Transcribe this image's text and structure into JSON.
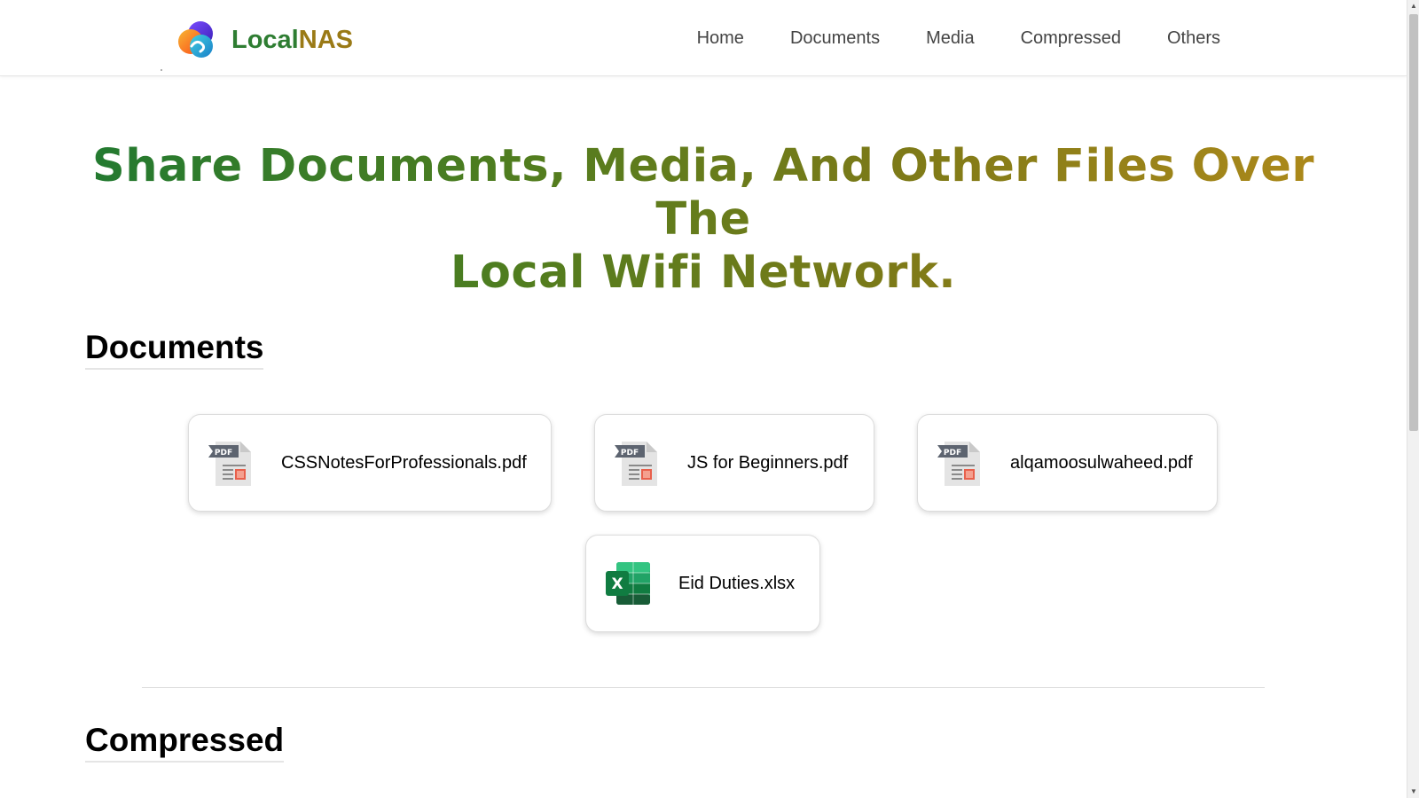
{
  "header": {
    "brand_local": "Local",
    "brand_nas": "NAS",
    "nav": [
      "Home",
      "Documents",
      "Media",
      "Compressed",
      "Others"
    ]
  },
  "hero": {
    "line1": "Share Documents, Media, And Other Files Over The",
    "line2": "Local Wifi Network."
  },
  "sections": {
    "documents_title": "Documents",
    "compressed_title": "Compressed"
  },
  "files": [
    {
      "name": "CSSNotesForProfessionals.pdf",
      "icon": "pdf-icon"
    },
    {
      "name": "JS for Beginners.pdf",
      "icon": "pdf-icon"
    },
    {
      "name": "alqamoosulwaheed.pdf",
      "icon": "pdf-icon"
    },
    {
      "name": "Eid Duties.xlsx",
      "icon": "excel-icon"
    }
  ],
  "icon_text": {
    "pdf": "PDF",
    "excel": "X"
  },
  "colors": {
    "brand_green": "#2e7d32",
    "brand_gold": "#9a7a16"
  }
}
